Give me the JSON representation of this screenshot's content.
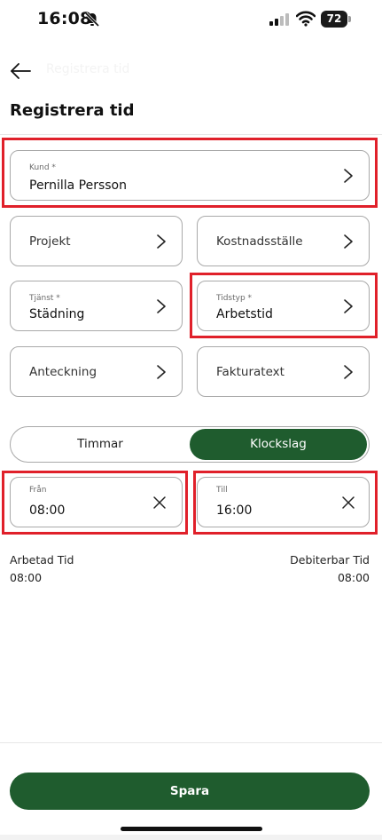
{
  "status_bar": {
    "time": "16:08",
    "battery": "72",
    "icons": [
      "bell-slash-icon",
      "signal-icon",
      "wifi-icon",
      "battery-icon"
    ]
  },
  "header": {
    "back_icon": "arrow-left-icon",
    "ghost_title": "Registrera tid",
    "title": "Registrera tid"
  },
  "form": {
    "kund": {
      "label": "Kund *",
      "value": "Pernilla Persson"
    },
    "projekt": {
      "label": "Projekt"
    },
    "kostnadsstalle": {
      "label": "Kostnadsställe"
    },
    "tjanst": {
      "label": "Tjänst *",
      "value": "Städning"
    },
    "tidstyp": {
      "label": "Tidstyp *",
      "value": "Arbetstid"
    },
    "anteckning": {
      "label": "Anteckning"
    },
    "fakturatext": {
      "label": "Fakturatext"
    }
  },
  "mode_toggle": {
    "options": [
      "Timmar",
      "Klockslag"
    ],
    "selected": "Klockslag"
  },
  "time_range": {
    "from": {
      "label": "Från",
      "value": "08:00"
    },
    "to": {
      "label": "Till",
      "value": "16:00"
    }
  },
  "summary": {
    "worked_label": "Arbetad Tid",
    "worked_value": "08:00",
    "billable_label": "Debiterbar Tid",
    "billable_value": "08:00"
  },
  "footer": {
    "save_label": "Spara"
  },
  "colors": {
    "brand_green": "#1f5c2e",
    "highlight_red": "#e0202a",
    "border_gray": "#a9a9a9"
  }
}
